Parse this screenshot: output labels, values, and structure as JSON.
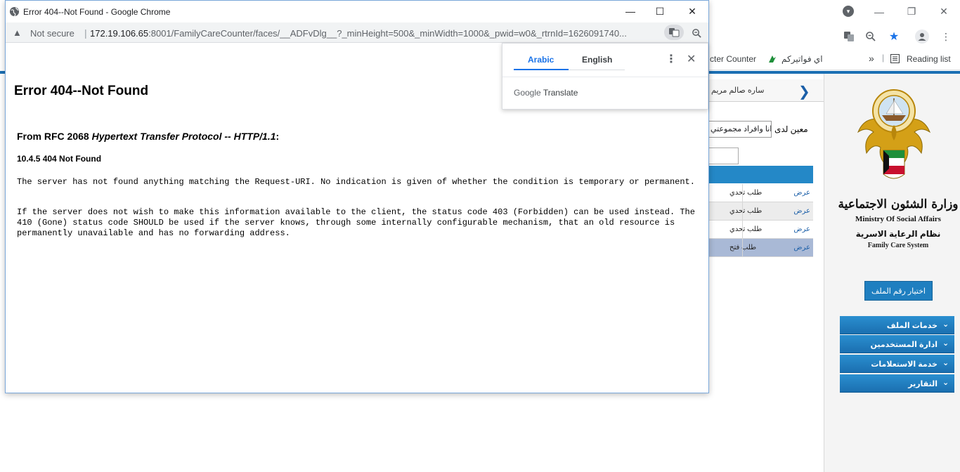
{
  "popup": {
    "title": "Error 404--Not Found - Google Chrome",
    "controls": {
      "minimize": "—",
      "maximize": "☐",
      "close": "✕"
    },
    "address": {
      "not_secure": "Not secure",
      "host": "172.19.106.65",
      "path": ":8001/FamilyCareCounter/faces/__ADFvDlg__?_minHeight=500&_minWidth=1000&_pwid=w0&_rtrnId=1626091740..."
    }
  },
  "error": {
    "heading": "Error 404--Not Found",
    "rfc_prefix": "From RFC 2068 ",
    "rfc_title": "Hypertext Transfer Protocol -- HTTP/1.1",
    "rfc_suffix": ":",
    "status": "10.4.5 404 Not Found",
    "para1": "The server has not found anything matching the Request-URI. No indication is given of whether the condition is temporary or permanent.",
    "para2": "If the server does not wish to make this information available to the client, the status code 403 (Forbidden) can be used instead. The 410 (Gone) status code SHOULD be used if the server knows, through some internally configurable mechanism, that an old resource is permanently unavailable and has no forwarding address."
  },
  "translate": {
    "tab_arabic": "Arabic",
    "tab_english": "English",
    "more": "⋮",
    "close": "✕",
    "brand_google": "Google",
    "brand_translate": "Translate"
  },
  "background": {
    "win_controls": {
      "minimize": "—",
      "restore": "❐",
      "close": "✕"
    },
    "bookmarks": {
      "counter": "cter Counter",
      "fawateer": "اي فواتيركم",
      "more": "»",
      "reading_list": "Reading list"
    },
    "breadcrumb": "ساره صالم مريم",
    "filter_label": "معين لدى",
    "filter_value": "انا وافراد مجموعتي",
    "rows": [
      {
        "link": "عرض",
        "text": "طلب تحدي"
      },
      {
        "link": "عرض",
        "text": "طلب تحدي"
      },
      {
        "link": "عرض",
        "text": "طلب تحدي"
      },
      {
        "link": "عرض",
        "text": "طلب فتح"
      }
    ],
    "sidebar": {
      "ministry_ar": "وزارة الشئون الاجتماعية",
      "ministry_en": "Ministry Of Social Affairs",
      "system_ar": "نظام الرعاية الاسرية",
      "system_en": "Family Care System",
      "select_file": "اختيار رقم الملف",
      "menu": [
        {
          "label": "خدمات الملف"
        },
        {
          "label": "ادارة المستخدمين"
        },
        {
          "label": "خدمة الاستعلامات"
        },
        {
          "label": "التقارير"
        }
      ]
    }
  },
  "colors": {
    "accent_blue": "#1b6fb3",
    "menu_blue": "#1f7fc0",
    "google_blue": "#1a73e8"
  }
}
